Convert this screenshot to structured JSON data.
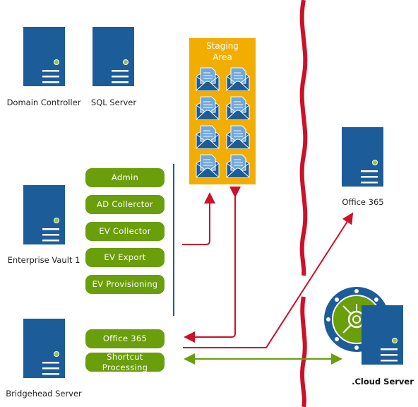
{
  "servers": {
    "domain_controller": "Domain Controller",
    "sql_server": "SQL Server",
    "enterprise_vault": "Enterprise Vault 1",
    "bridgehead": "Bridgehead Server",
    "office365": "Office 365",
    "cloud": ".Cloud Server"
  },
  "staging": {
    "title_line1": "Staging",
    "title_line2": "Area",
    "envelope_count": 8
  },
  "modules": [
    "Admin",
    "AD Collerctor",
    "EV Collector",
    "EV Export",
    "EV Provisioning"
  ],
  "bridgehead_modules": [
    "Office 365",
    "Shortcut Processing"
  ],
  "colors": {
    "server": "#1c5c99",
    "module": "#6a9e0a",
    "staging": "#f2ae00",
    "arrow_red": "#cc1128",
    "arrow_green": "#6a9e0a",
    "firewall": "#cc1128"
  }
}
